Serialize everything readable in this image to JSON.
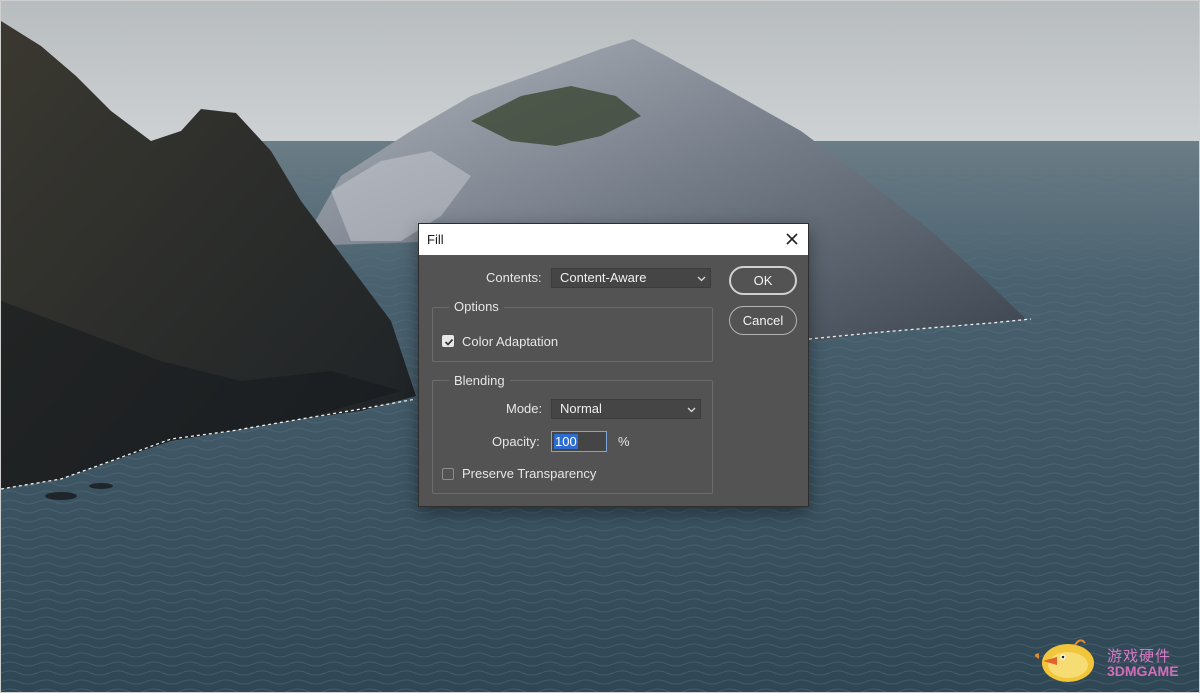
{
  "dialog": {
    "title": "Fill",
    "contents_label": "Contents:",
    "contents_value": "Content-Aware",
    "options_group": "Options",
    "color_adaptation_label": "Color Adaptation",
    "color_adaptation_checked": true,
    "blending_group": "Blending",
    "mode_label": "Mode:",
    "mode_value": "Normal",
    "opacity_label": "Opacity:",
    "opacity_value": "100",
    "opacity_unit": "%",
    "preserve_transparency_label": "Preserve Transparency",
    "preserve_transparency_checked": false,
    "ok_label": "OK",
    "cancel_label": "Cancel"
  },
  "watermark": {
    "chinese": "游戏硬件",
    "brand": "3DMGAME"
  },
  "colors": {
    "dialog_bg": "#535353",
    "field_bg": "#454545",
    "selection_blue": "#2d6cd0",
    "sea": "#3f5764",
    "sky": "#c4c9cc"
  },
  "icons": {
    "close": "close-icon",
    "dropdown": "chevron-down-icon",
    "check": "checkmark-icon",
    "mascot": "chick-mascot-icon"
  }
}
